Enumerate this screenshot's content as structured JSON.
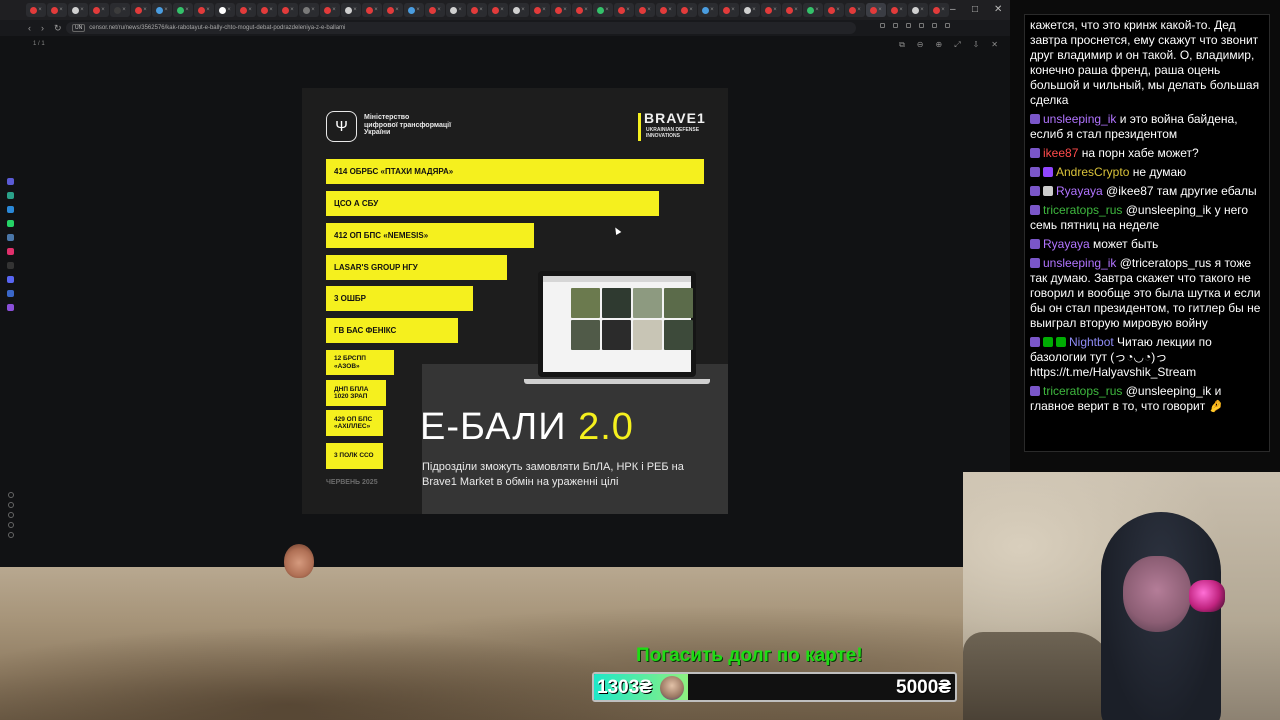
{
  "browser": {
    "url": "censor.net/ru/news/3562576/kak-rabotayut-e-bally-chto-mogut-debat-podrazdeleniya-z-e-ballami",
    "url_badge": "UN",
    "page_count": "1 / 1",
    "window_controls": [
      "–",
      "□",
      "✕"
    ]
  },
  "card": {
    "ministry_lines": [
      "Міністерство",
      "цифрової трансформації",
      "України"
    ],
    "brave_title": "BRAVE1",
    "brave_sub_lines": [
      "UKRAINIAN DEFENSE",
      "INNOVATIONS"
    ],
    "units": [
      {
        "label": "414 ОБРБС «ПТАХИ МАДЯРА»",
        "score": 1.0
      },
      {
        "label": "ЦСО А СБУ",
        "score": 0.88
      },
      {
        "label": "412 ОП БПС «NEMESIS»",
        "score": 0.55
      },
      {
        "label": "LASAR'S GROUP НГУ",
        "score": 0.48
      },
      {
        "label": "3 ОШБР",
        "score": 0.39
      },
      {
        "label": "ГВ БАС ФЕНІКС",
        "score": 0.35
      },
      {
        "label": "12 БРСПП «АЗОВ»",
        "score": 0.18
      },
      {
        "label": "ДНП БПЛА 1020 ЗРАП",
        "score": 0.16
      },
      {
        "label": "429 ОП БПС «АХІЛЛЕС»",
        "score": 0.15
      },
      {
        "label": "3 ПОЛК ССО",
        "score": 0.15
      }
    ],
    "title_main": "Е-БАЛИ",
    "title_version": "2.0",
    "subtitle": "Підрозділи зможуть замовляти БпЛА, НРК і РЕБ на Brave1 Market в обмін на ураженні цілі",
    "date": "ЧЕРВЕНЬ 2025"
  },
  "goal": {
    "title": "Погасить долг по карте!",
    "current": "1303₴",
    "target": "5000₴",
    "progress": 0.26,
    "colors": {
      "title": "#1fdc14",
      "fill_start": "#1ee8c8",
      "fill_end": "#8ef080"
    }
  },
  "chat": {
    "messages": [
      {
        "user": "",
        "color": "#ffffff",
        "badges": [],
        "text": "кажется, что это кринж какой-то. Дед завтра проснется, ему скажут что звонит друг владимир и он такой. О, владимир, конечно раша френд, раша оцень большой и чильный, мы делать большая сделка"
      },
      {
        "user": "unsleeping_ik",
        "color": "#b174ff",
        "badges": [
          "#7a56c9"
        ],
        "text": "и это война байдена, еслиб я стал президентом"
      },
      {
        "user": "ikee87",
        "color": "#ff4b4b",
        "badges": [
          "#7a56c9"
        ],
        "text": "на порн хабе может?"
      },
      {
        "user": "AndresCrypto",
        "color": "#d9c23a",
        "badges": [
          "#7a56c9",
          "#9146ff"
        ],
        "text": "не думаю"
      },
      {
        "user": "Ryayaya",
        "color": "#b174ff",
        "badges": [
          "#7a56c9",
          "#cccccc"
        ],
        "text": "@ikee87 там другие ебалы"
      },
      {
        "user": "triceratops_rus",
        "color": "#3fb83f",
        "badges": [
          "#7a56c9"
        ],
        "text": "@unsleeping_ik у него семь пятниц на неделе"
      },
      {
        "user": "Ryayaya",
        "color": "#b174ff",
        "badges": [
          "#7a56c9"
        ],
        "text": "может быть"
      },
      {
        "user": "unsleeping_ik",
        "color": "#b174ff",
        "badges": [
          "#7a56c9"
        ],
        "text": "@triceratops_rus я тоже так думаю. Завтра скажет что такого не говорил и вообще это была шутка и если бы он стал президентом, то гитлер бы не выиграл вторую мировую войну"
      },
      {
        "user": "Nightbot",
        "color": "#8f8cf5",
        "badges": [
          "#7a56c9",
          "#00ad03",
          "#00ad03"
        ],
        "text": "Читаю лекции по базологии тут (っ◔◡◔)っ https://t.me/Halyavshik_Stream"
      },
      {
        "user": "triceratops_rus",
        "color": "#3fb83f",
        "badges": [
          "#7a56c9"
        ],
        "text": "@unsleeping_ik и главное верит в то, что говорит 🤌"
      }
    ]
  }
}
